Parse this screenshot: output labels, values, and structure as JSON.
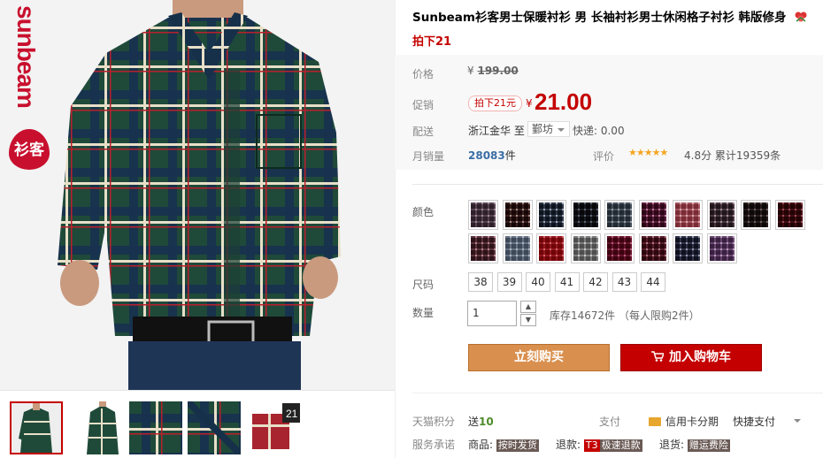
{
  "product": {
    "title": "Sunbeam衫客男士保暖衬衫 男 长袖衬衫男士休闲格子衬衫 韩版修身",
    "subtitle": "拍下21",
    "brand_logo_text": "sunbeam",
    "brand_logo_cn": "衫客"
  },
  "price": {
    "orig_label": "价格",
    "orig_currency": "¥",
    "orig_value": "199.00",
    "promo_label": "促销",
    "promo_badge": "拍下21元",
    "currency": "¥",
    "value": "21.00"
  },
  "shipping": {
    "label": "配送",
    "from": "浙江金华  至",
    "to_city": "鄞坊",
    "express": "快递: 0.00"
  },
  "sales": {
    "label": "月销量",
    "count": "28083",
    "unit": "件",
    "rating_label": "评价",
    "stars": "★★★★★",
    "score": "4.8分",
    "reviews": "累计19359条"
  },
  "colors": {
    "label": "颜色",
    "swatches": [
      {
        "a": "#6b5b66",
        "b": "#c9b8c3"
      },
      {
        "a": "#4b2a2a",
        "b": "#c9c0bb"
      },
      {
        "a": "#3b4656",
        "b": "#c9cdd6"
      },
      {
        "a": "#2b2b33",
        "b": "#9aa0aa"
      },
      {
        "a": "#5c6670",
        "b": "#c6c9cf"
      },
      {
        "a": "#6a2a4a",
        "b": "#d8b4c8"
      },
      {
        "a": "#b06a74",
        "b": "#ecd0d4"
      },
      {
        "a": "#5a4a52",
        "b": "#cdbfc6"
      },
      {
        "a": "#3a2e2e",
        "b": "#a79e9c"
      },
      {
        "a": "#5a1a22",
        "b": "#c28e95"
      },
      {
        "a": "#6b4650",
        "b": "#d6b7be"
      },
      {
        "a": "#7d8896",
        "b": "#d3d8de"
      },
      {
        "a": "#a8242e",
        "b": "#e3a2a6"
      },
      {
        "a": "#8d8d8d",
        "b": "#e3e3e3"
      },
      {
        "a": "#7b1f3e",
        "b": "#d49bb0"
      },
      {
        "a": "#6a2a3a",
        "b": "#d2b3bb"
      },
      {
        "a": "#3e4258",
        "b": "#c4c6d2"
      },
      {
        "a": "#7a5a80",
        "b": "#d9c7dc"
      }
    ]
  },
  "sizes": {
    "label": "尺码",
    "options": [
      "38",
      "39",
      "40",
      "41",
      "42",
      "43",
      "44"
    ]
  },
  "quantity": {
    "label": "数量",
    "value": "1",
    "stock": "库存14672件 （每人限购2件）"
  },
  "actions": {
    "buy_now": "立刻购买",
    "add_to_cart": "加入购物车"
  },
  "footer": {
    "points_label": "天猫积分",
    "points_prefix": "送",
    "points_value": "10",
    "pay_label": "支付",
    "pay_card": "信用卡分期",
    "pay_quick": "快捷支付",
    "promise_label": "服务承诺",
    "promise_goods": "商品:",
    "promise_goods_tag": "按时发货",
    "promise_refund": "退款:",
    "promise_refund_t3": "T3",
    "promise_refund_tag": "极速退款",
    "promise_return": "退货:",
    "promise_return_tag": "赠运费险"
  },
  "colors_theme": {
    "accent": "#c40000",
    "buy": "#d9904f",
    "cart": "#c40000"
  }
}
